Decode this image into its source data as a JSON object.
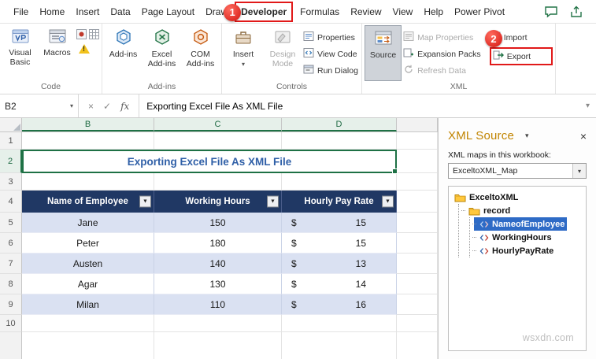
{
  "tabs": [
    "File",
    "Home",
    "Insert",
    "Data",
    "Page Layout",
    "Draw",
    "Developer",
    "Formulas",
    "Review",
    "View",
    "Help",
    "Power Pivot"
  ],
  "annotations": {
    "step1": "1",
    "step2": "2"
  },
  "icons": {
    "dropdown": "▾",
    "filter": "▼",
    "close": "×",
    "cancel": "×",
    "check": "✓",
    "fx": "fx",
    "expand": "▾"
  },
  "ribbon": {
    "code": {
      "label": "Code",
      "visual_basic": "Visual Basic",
      "macros": "Macros"
    },
    "addins": {
      "label": "Add-ins",
      "addins": "Add-ins",
      "excel_addins": "Excel Add-ins",
      "com_addins": "COM Add-ins"
    },
    "controls": {
      "label": "Controls",
      "insert": "Insert",
      "design_mode": "Design Mode",
      "properties": "Properties",
      "view_code": "View Code",
      "run_dialog": "Run Dialog"
    },
    "xml": {
      "label": "XML",
      "source": "Source",
      "map_properties": "Map Properties",
      "expansion_packs": "Expansion Packs",
      "refresh_data": "Refresh Data",
      "import": "Import",
      "export": "Export"
    }
  },
  "formula_bar": {
    "name_box": "B2",
    "formula": "Exporting Excel File As XML File"
  },
  "sheet": {
    "columns": [
      "B",
      "C",
      "D"
    ],
    "row_numbers": [
      "1",
      "2",
      "3",
      "4",
      "5",
      "6",
      "7",
      "8",
      "9",
      "10"
    ],
    "title": "Exporting Excel File As XML File",
    "table": {
      "headers": [
        "Name of Employee",
        "Working Hours",
        "Hourly Pay Rate"
      ],
      "rows": [
        {
          "name": "Jane",
          "hours": "150",
          "currency": "$",
          "rate": "15"
        },
        {
          "name": "Peter",
          "hours": "180",
          "currency": "$",
          "rate": "15"
        },
        {
          "name": "Austen",
          "hours": "140",
          "currency": "$",
          "rate": "13"
        },
        {
          "name": "Agar",
          "hours": "130",
          "currency": "$",
          "rate": "14"
        },
        {
          "name": "Milan",
          "hours": "110",
          "currency": "$",
          "rate": "16"
        }
      ]
    }
  },
  "xml_panel": {
    "title": "XML Source",
    "maps_label": "XML maps in this workbook:",
    "map_name": "ExceltoXML_Map",
    "tree": {
      "root": "ExceltoXML",
      "record": "record",
      "fields": [
        "NameofEmployee",
        "WorkingHours",
        "HourlyPayRate"
      ]
    }
  },
  "watermark": "wsxdn.com",
  "colors": {
    "accent_green": "#217346",
    "annotation_red": "#E11919",
    "table_header_navy": "#203864",
    "row_band_lavender": "#DAE1F2",
    "selected_node_blue": "#2E6BC6",
    "xml_title_gold": "#C18400",
    "sheet_title_blue": "#2F5FA7"
  }
}
